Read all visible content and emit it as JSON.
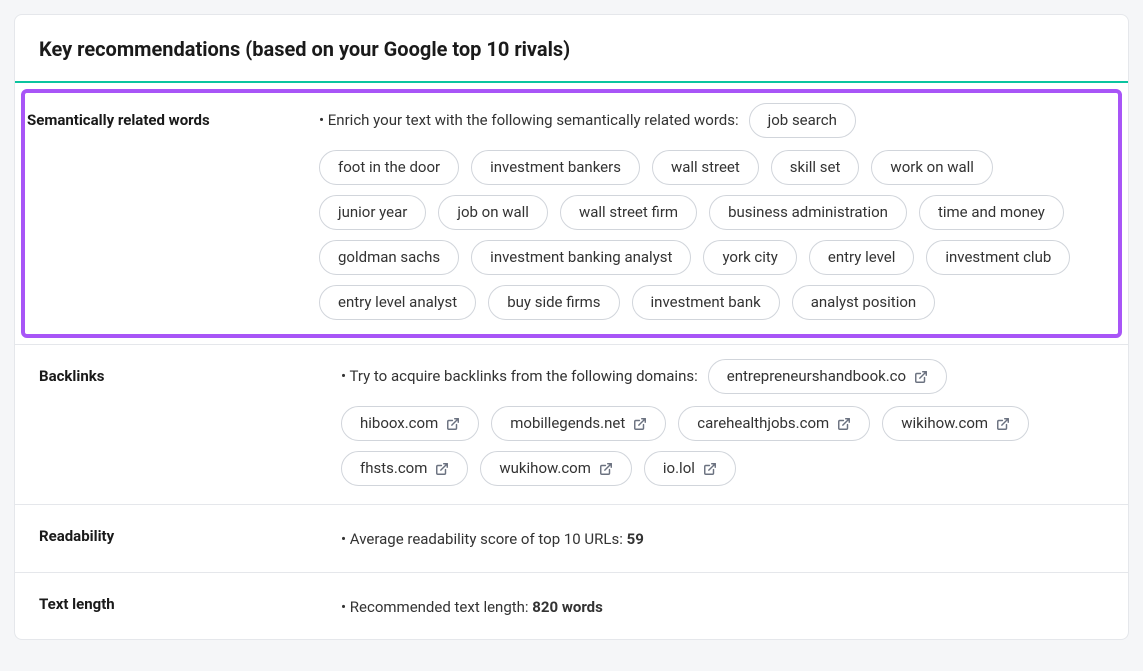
{
  "header": {
    "title": "Key recommendations (based on your Google top 10 rivals)"
  },
  "sections": {
    "semantic": {
      "label": "Semantically related words",
      "intro": "• Enrich your text with the following semantically related words:",
      "words": [
        "job search",
        "foot in the door",
        "investment bankers",
        "wall street",
        "skill set",
        "work on wall",
        "junior year",
        "job on wall",
        "wall street firm",
        "business administration",
        "time and money",
        "goldman sachs",
        "investment banking analyst",
        "york city",
        "entry level",
        "investment club",
        "entry level analyst",
        "buy side firms",
        "investment bank",
        "analyst position"
      ]
    },
    "backlinks": {
      "label": "Backlinks",
      "intro": "• Try to acquire backlinks from the following domains:",
      "domains": [
        "entrepreneurshandbook.co",
        "hiboox.com",
        "mobillegends.net",
        "carehealthjobs.com",
        "wikihow.com",
        "fhsts.com",
        "wukihow.com",
        "io.lol"
      ]
    },
    "readability": {
      "label": "Readability",
      "text_prefix": "• Average readability score of top 10 URLs: ",
      "value": "59"
    },
    "textlength": {
      "label": "Text length",
      "text_prefix": "• Recommended text length: ",
      "value": "820 words"
    }
  }
}
